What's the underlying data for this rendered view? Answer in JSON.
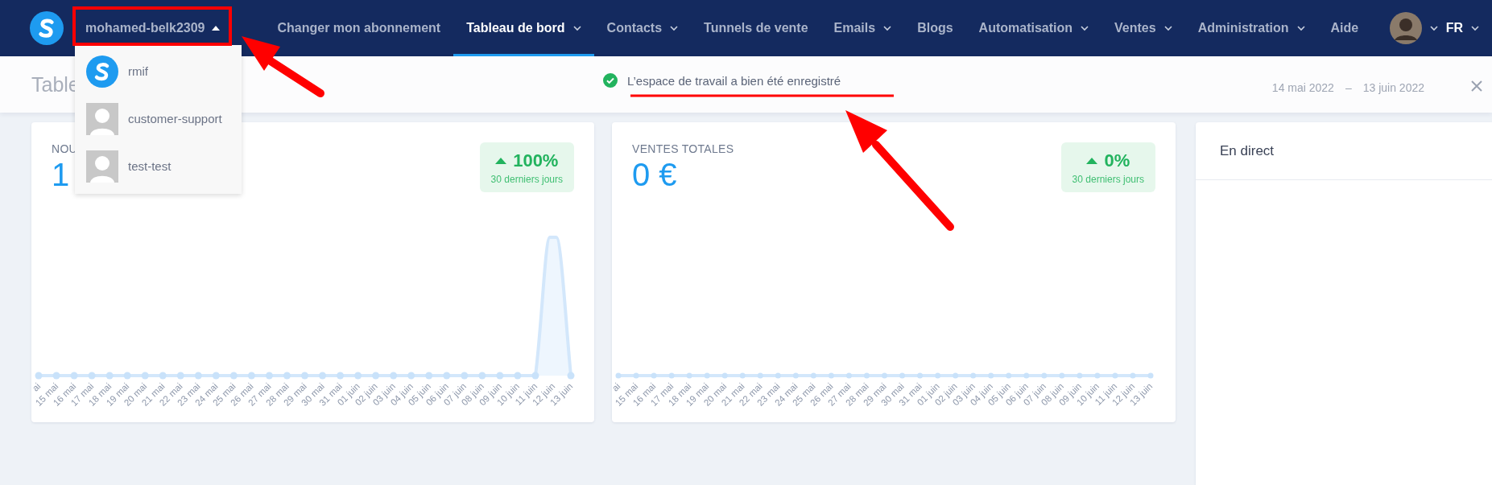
{
  "nav": {
    "account": {
      "name": "mohamed-belk2309",
      "expanded": true
    },
    "items": [
      {
        "label": "Changer mon abonnement",
        "selected": false,
        "dropdown": false
      },
      {
        "label": "Tableau de bord",
        "selected": true,
        "dropdown": true
      },
      {
        "label": "Contacts",
        "selected": false,
        "dropdown": true
      },
      {
        "label": "Tunnels de vente",
        "selected": false,
        "dropdown": false
      },
      {
        "label": "Emails",
        "selected": false,
        "dropdown": true
      },
      {
        "label": "Blogs",
        "selected": false,
        "dropdown": false
      },
      {
        "label": "Automatisation",
        "selected": false,
        "dropdown": true
      },
      {
        "label": "Ventes",
        "selected": false,
        "dropdown": true
      },
      {
        "label": "Administration",
        "selected": false,
        "dropdown": true
      },
      {
        "label": "Aide",
        "selected": false,
        "dropdown": false
      }
    ],
    "language": "FR"
  },
  "account_menu": [
    {
      "name": "rmif",
      "kind": "logo"
    },
    {
      "name": "customer-support",
      "kind": "placeholder"
    },
    {
      "name": "test-test",
      "kind": "placeholder"
    }
  ],
  "subheader": {
    "title": "Table",
    "notification": "L’espace de travail a bien été enregistré",
    "date_start": "14 mai 2022",
    "date_separator": "–",
    "date_end": "13 juin 2022"
  },
  "cards": [
    {
      "title": "NOU",
      "value": "1",
      "change": "100%",
      "period": "30 derniers jours",
      "chart": {
        "kind": "spike",
        "x_labels": [
          "ai",
          "15 mai",
          "16 mai",
          "17 mai",
          "18 mai",
          "19 mai",
          "20 mai",
          "21 mai",
          "22 mai",
          "23 mai",
          "24 mai",
          "25 mai",
          "26 mai",
          "27 mai",
          "28 mai",
          "29 mai",
          "30 mai",
          "31 mai",
          "01 juin",
          "02 juin",
          "03 juin",
          "04 juin",
          "05 juin",
          "06 juin",
          "07 juin",
          "08 juin",
          "09 juin",
          "10 juin",
          "11 juin",
          "12 juin",
          "13 juin"
        ]
      }
    },
    {
      "title": "VENTES TOTALES",
      "value": "0 €",
      "change": "0%",
      "period": "30 derniers jours",
      "chart": {
        "kind": "flat",
        "x_labels": [
          "ai",
          "15 mai",
          "16 mai",
          "17 mai",
          "18 mai",
          "19 mai",
          "20 mai",
          "21 mai",
          "22 mai",
          "23 mai",
          "24 mai",
          "25 mai",
          "26 mai",
          "27 mai",
          "28 mai",
          "29 mai",
          "30 mai",
          "31 mai",
          "01 juin",
          "02 juin",
          "03 juin",
          "04 juin",
          "05 juin",
          "06 juin",
          "07 juin",
          "08 juin",
          "09 juin",
          "10 juin",
          "11 juin",
          "12 juin",
          "13 juin"
        ]
      }
    }
  ],
  "live": {
    "title": "En direct"
  }
}
